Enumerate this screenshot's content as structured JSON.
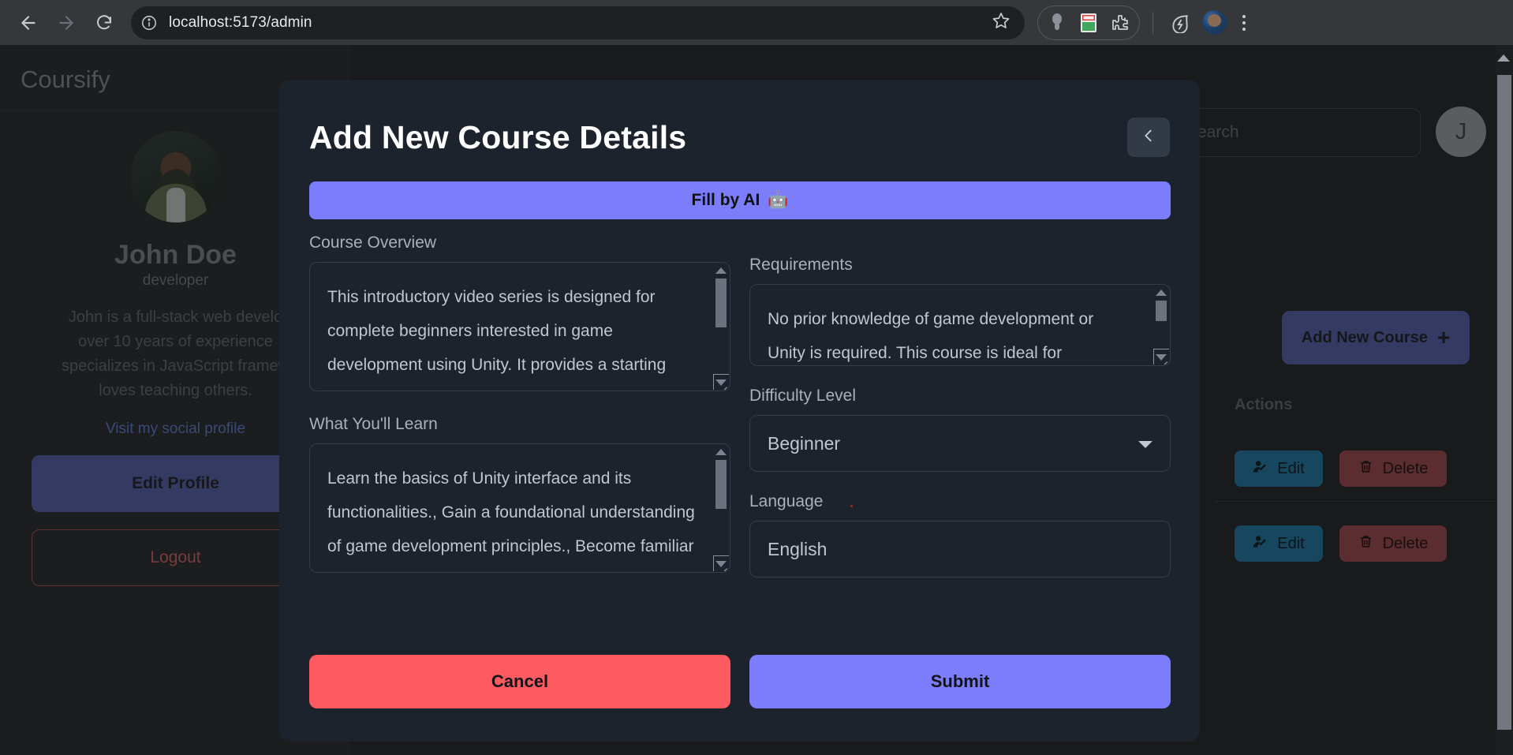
{
  "browser": {
    "back_label": "Back",
    "forward_label": "Forward",
    "reload_label": "Reload",
    "url": "localhost:5173/admin",
    "bookmark_label": "Bookmark this tab",
    "extensions_label": "Extensions",
    "profile_initial": "",
    "menu_label": "Customize and control"
  },
  "sidebar": {
    "brand": "Coursify",
    "name": "John Doe",
    "role": "developer",
    "bio": "John is a full-stack web develo\nover 10 years of experience\nspecializes in JavaScript framew\nloves teaching others.",
    "social_link": "Visit my social profile",
    "edit_profile": "Edit Profile",
    "logout": "Logout"
  },
  "topbar": {
    "search_placeholder": "Search",
    "avatar_initial": "J"
  },
  "courses_panel": {
    "add_new_course": "Add New Course",
    "add_icon": "+",
    "actions_header": "Actions",
    "rows": [
      {
        "edit": "Edit",
        "delete": "Delete"
      },
      {
        "edit": "Edit",
        "delete": "Delete"
      }
    ]
  },
  "modal": {
    "title": "Add New Course Details",
    "back_icon": "chevron-left",
    "fill_by_ai": "Fill by AI",
    "fill_by_ai_icon": "🤖",
    "fields": {
      "course_overview": {
        "label": "Course Overview",
        "value": "This introductory video series is designed for complete beginners interested in game development using Unity. It provides a starting point for individuals who want to learn how to"
      },
      "what_you_will_learn": {
        "label": "What You'll Learn",
        "value": "Learn the basics of Unity interface and its functionalities., Gain a foundational understanding of game development principles., Become familiar with essential tools and concepts for creating a"
      },
      "requirements": {
        "label": "Requirements",
        "value": "No prior knowledge of game development or Unity is required. This course is ideal for beginners with a"
      },
      "difficulty_level": {
        "label": "Difficulty Level",
        "value": "Beginner"
      },
      "language": {
        "label": "Language",
        "value": "English"
      }
    },
    "cancel": "Cancel",
    "submit": "Submit"
  },
  "colors": {
    "accent_purple": "#7b7dfa",
    "danger_red": "#fd5a61",
    "modal_bg": "#1d232d",
    "page_bg": "#191a1c"
  }
}
